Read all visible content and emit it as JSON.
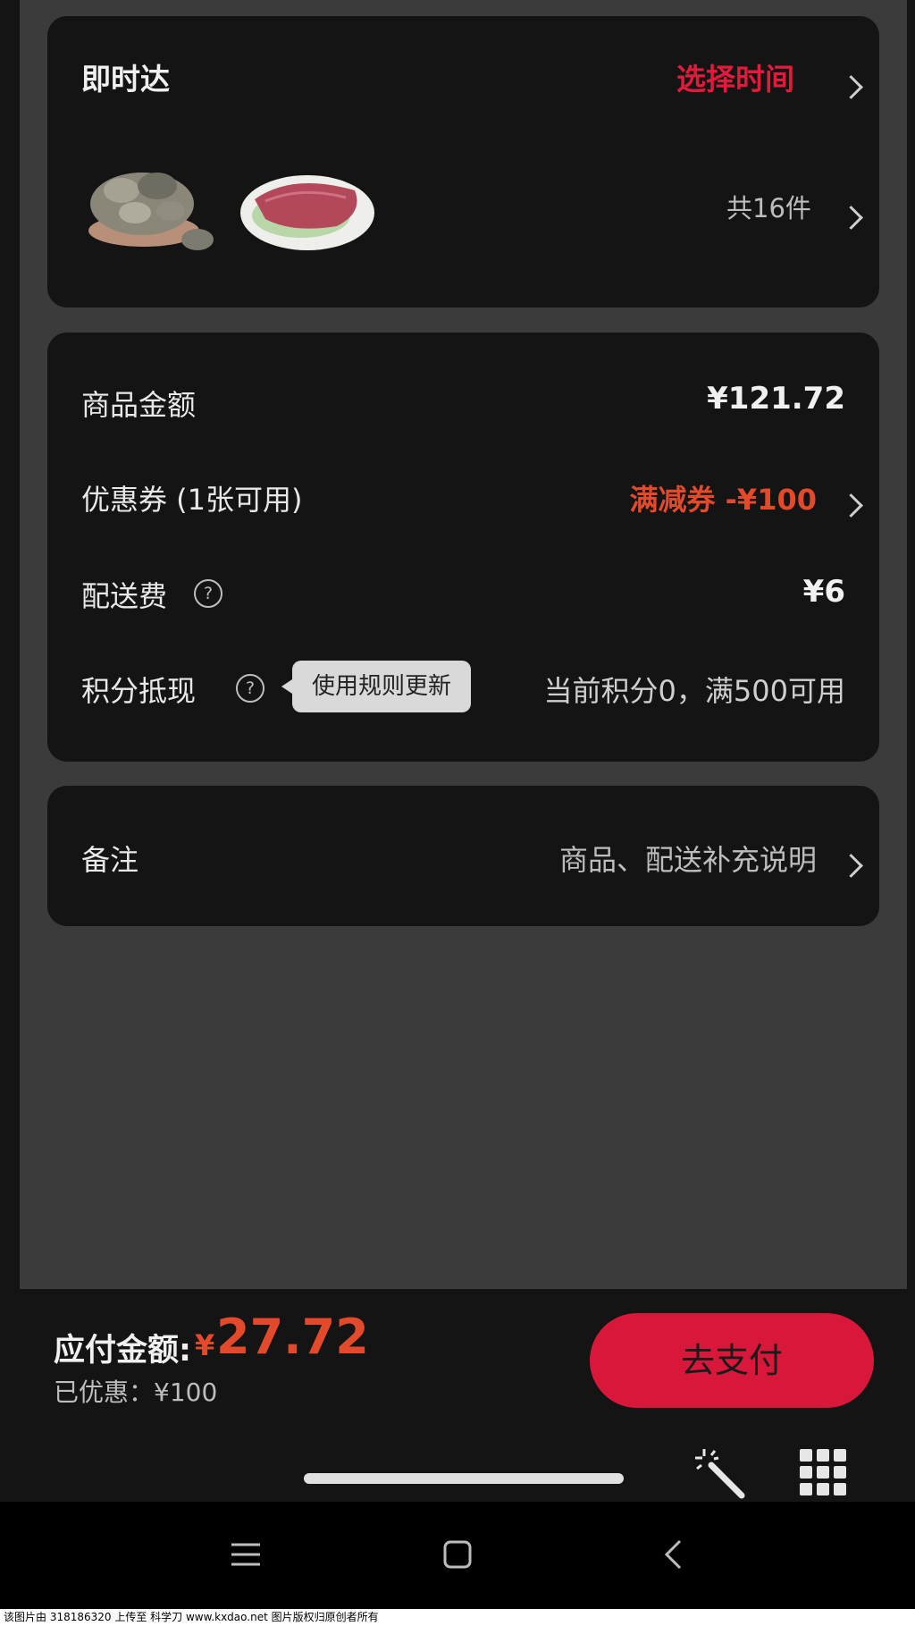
{
  "delivery": {
    "title": "即时达",
    "select_time": "选择时间",
    "item_count": "共16件",
    "products": [
      "oysters-plate-image",
      "tuna-sashimi-image"
    ]
  },
  "summary": {
    "goods_label": "商品金额",
    "goods_value": "¥121.72",
    "coupon_label": "优惠券 (1张可用)",
    "coupon_value": "满减券 -¥100",
    "shipping_label": "配送费",
    "shipping_value": "¥6",
    "points_label": "积分抵现",
    "points_tooltip": "使用规则更新",
    "points_value": "当前积分0，满500可用"
  },
  "remark": {
    "label": "备注",
    "placeholder": "商品、配送补充说明"
  },
  "footer": {
    "payable_label": "应付金额:",
    "currency": "¥",
    "payable_amount": "27.72",
    "discount_text": "已优惠：¥100",
    "pay_button": "去支付"
  },
  "icons": {
    "help": "?",
    "magic": "magic-wand-icon",
    "grid": "grid-icon",
    "nav_menu": "menu-icon",
    "nav_home": "home-icon",
    "nav_back": "back-icon"
  },
  "watermark": "该图片由 318186320 上传至 科学刀 www.kxdao.net 图片版权归原创者所有",
  "colors": {
    "accent_red": "#d8183a",
    "price_red": "#e34a2c",
    "card_bg": "#141414",
    "page_bg": "#3b3b3b"
  }
}
